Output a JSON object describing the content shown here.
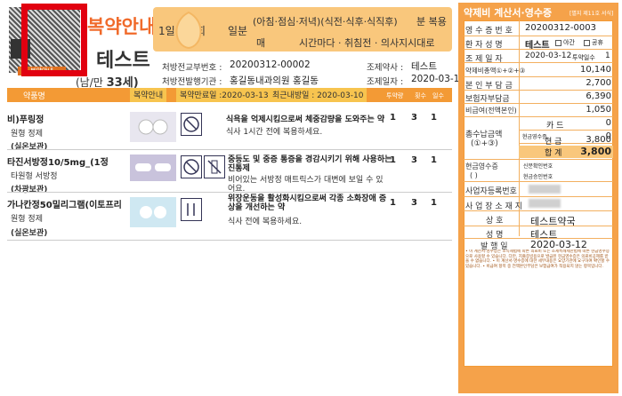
{
  "header": {
    "brand_title": "복약안내",
    "pharmacy_name": "테스트",
    "gender_age_prefix": "(남/만",
    "gender_age_value": "33세)",
    "qr_caption": "복약안내"
  },
  "dose_panel": {
    "days_value": "1일",
    "times": "회",
    "count": "일분",
    "meal_times": "(아침·점심·저녁)(식전·식후·식직후)",
    "dose_label": "분 복용",
    "every": "매",
    "interval": "시간마다 · 취침전 · 의사지시대로"
  },
  "prescription": {
    "rx_number_label": "처방전교부번호 :",
    "rx_number": "20200312-00002",
    "pharmacist_label": "조제약사 :",
    "pharmacist": "테스트",
    "issuer_label": "처방전발행기관 :",
    "issuer": "홍길동내과의원 홍길동",
    "dispense_date_label": "조제일자 :",
    "dispense_date": "2020-03-12"
  },
  "table": {
    "col_drug": "약품명",
    "col_guide": "복약안내",
    "expiry": "복약만료일 :2020-03-13",
    "next_visit": "최근내방일 : 2020-03-10",
    "col_dose": "투약량",
    "col_times": "횟수",
    "col_days": "일수"
  },
  "drugs": [
    {
      "name": "비)푸링정",
      "type": "원형 정제",
      "storage": "(실온보관)",
      "desc1": "식욕을 억제시킴으로써 체중감량을 도와주는 약",
      "desc2": "식사 1시간 전에 복용하세요.",
      "dose": "1",
      "times": "3",
      "days": "1"
    },
    {
      "name": "타진서방정10/5mg_(1정",
      "type": "타원형 서방정",
      "storage": "(차광보관)",
      "desc1": "중등도 및 중증 통증을 경감시키기 위해 사용하는 진통제",
      "desc2": "비어있는 서방정 매트릭스가 대변에 보일 수 있어요.",
      "dose": "1",
      "times": "3",
      "days": "1"
    },
    {
      "name": "가나칸정50밀리그램(이토프리",
      "type": "원형 정제",
      "storage": "(실온보관)",
      "desc1": "위장운동을 활성화시킴으로써 각종 소화장애 증상을 개선하는 약",
      "desc2": "식사 전에 복용하세요.",
      "dose": "1",
      "times": "3",
      "days": "1"
    }
  ],
  "receipt": {
    "title": "약제비 계산서·영수증",
    "ref": "[별지 제11호 서식]",
    "receipt_no_label": "영 수 증 번 호",
    "receipt_no": "20200312-0003",
    "patient_label": "환 자 성 명",
    "patient": "테스트",
    "night": "야간",
    "holiday": "공휴",
    "dispense_date_label": "조 제 일 자",
    "dispense_date": "2020-03-12",
    "dispense_days_label": "투약일수",
    "dispense_days": "1",
    "total_label": "약제비총액①+②+③",
    "total": "10,140",
    "self_pay_label": "본 인 부 담 금",
    "self_pay": "2,700",
    "insurer_pay_label": "보험자부담금",
    "insurer_pay": "6,390",
    "non_covered_label": "비급여(전액본인)",
    "non_covered": "1,050",
    "card_label": "카 드",
    "card": "0",
    "total_paid_label": "총수납금액",
    "total_paid_sub": "(①+③)",
    "cash_receipt_label": "현금영수증",
    "cash_receipt_value": "0",
    "cash_label": "현 금",
    "cash": "3,800",
    "sum_label": "합 계",
    "sum": "3,800",
    "cash_receipt_id_label": "현금영수증",
    "cash_receipt_id_sub": "( )",
    "approval_label": "신분확인번호",
    "approval_no_label": "현금승인번호",
    "biz_no_label": "사업자등록번호",
    "address_label": "사 업 장 소 재 지",
    "pharmacy_name_label": "상 호",
    "pharmacy_name": "테스트약국",
    "owner_label": "성 명",
    "owner": "테스트",
    "issue_label": "발 행 일",
    "issue_date": "2020-03-12",
    "fine_print": "• 이 계산서·영수증은 소득세법에 따른 의료비 또는 조세특례제한법에 따른 현금영수증으로 사용할 수 있습니다. 다만, 지출증빙용으로 발급된 현금영수증은 의료비공제를 받을 수 없습니다. • 이 계산서·영수증에 대한 세부내용은 요양기관에 요구하여 확인할 수 있습니다. • 비급여 항목 중 전액본인부담은 보험급여가 적용되지 않는 항목입니다."
  }
}
